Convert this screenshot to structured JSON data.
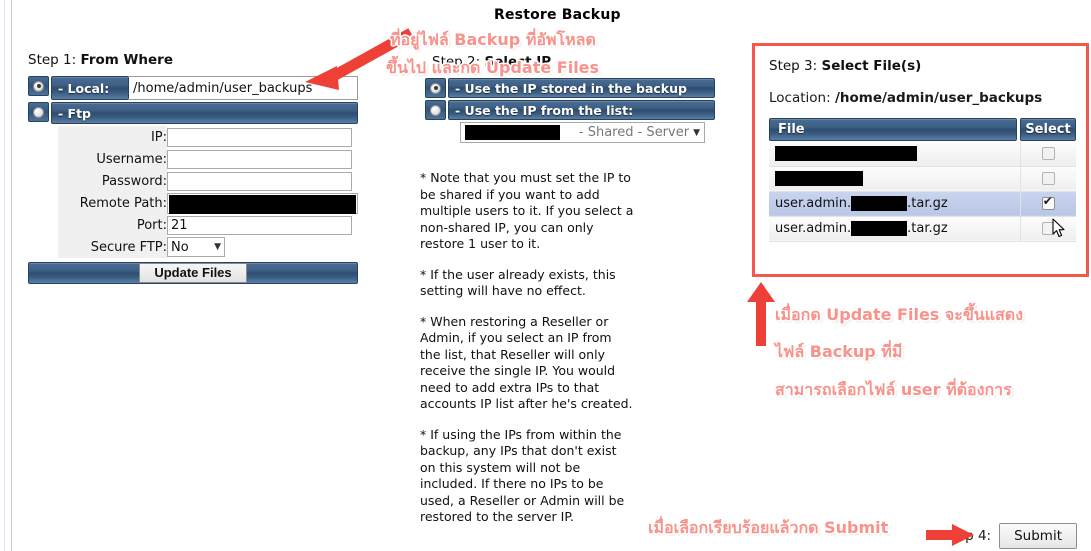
{
  "page": {
    "title": "Restore Backup"
  },
  "step1": {
    "heading_prefix": "Step 1:",
    "heading": "From Where",
    "local": {
      "label": "- Local:",
      "value": "/home/admin/user_backups"
    },
    "ftp": {
      "label": "- Ftp"
    },
    "fields": [
      {
        "label": "IP:",
        "value": "",
        "redacted": false
      },
      {
        "label": "Username:",
        "value": "",
        "redacted": false
      },
      {
        "label": "Password:",
        "value": "",
        "redacted": false
      },
      {
        "label": "Remote Path:",
        "value": "",
        "redacted": true
      },
      {
        "label": "Port:",
        "value": "21",
        "redacted": false
      }
    ],
    "secure_ftp": {
      "label": "Secure FTP:",
      "value": "No"
    },
    "update_button": "Update Files"
  },
  "step2": {
    "heading_prefix": "Step 2:",
    "heading": "Select IP",
    "option_backup": "- Use the IP stored in the backup",
    "option_list": "- Use the IP from the list:",
    "ip_select_value": "- Shared - Server",
    "notes": [
      "* Note that you must set the IP to be shared if you want to add multiple users to it. If you select a non-shared IP, you can only restore 1 user to it.",
      "* If the user already exists, this setting will have no effect.",
      "* When restoring a Reseller or Admin, if you select an IP from the list, that Reseller will only receive the single IP. You would need to add extra IPs to that accounts IP list after he's created.",
      "* If using the IPs from within the backup, any IPs that don't exist on this system will not be included. If there no IPs to be used, a Reseller or Admin will be restored to the server IP."
    ]
  },
  "step3": {
    "heading_prefix": "Step 3:",
    "heading": "Select File(s)",
    "location_label": "Location:",
    "location_value": "/home/admin/user_backups",
    "columns": [
      "File",
      "Select"
    ],
    "rows": [
      {
        "file": "",
        "redacted": true,
        "redact_width": 142,
        "checked": false,
        "selected": false,
        "prefix": "",
        "suffix": ""
      },
      {
        "file": "",
        "redacted": true,
        "redact_width": 88,
        "checked": false,
        "selected": false,
        "prefix": "",
        "suffix": ""
      },
      {
        "file": "user.admin.██████.tar.gz",
        "redacted": true,
        "redact_width": 52,
        "checked": true,
        "selected": true,
        "prefix": "user.admin.",
        "suffix": ".tar.gz"
      },
      {
        "file": "user.admin.██████.tar.gz",
        "redacted": true,
        "redact_width": 52,
        "checked": false,
        "selected": false,
        "prefix": "user.admin.",
        "suffix": ".tar.gz"
      }
    ]
  },
  "step4": {
    "label": "Step 4:",
    "submit": "Submit"
  },
  "annotations": {
    "thai_1": "ที่อยู่ไฟล์ Backup ที่อัพโหลด",
    "thai_2": "ขึ้นไป และกด Update Files",
    "thai_3": "เมื่อกด Update Files จะขึ้นแสดง",
    "thai_4": "ไฟล์ Backup ที่มี",
    "thai_5": "สามารถเลือกไฟล์ user ที่ต้องการ",
    "thai_6": "เมื่อเลือกเรียบร้อยแล้วกด Submit"
  },
  "colors": {
    "annotation_red": "#f8938c",
    "arrow_red": "#ee4036",
    "panel_border": "#f4574d",
    "bar_blue": "#3d5f85",
    "row_selected": "#c9d4ee"
  }
}
